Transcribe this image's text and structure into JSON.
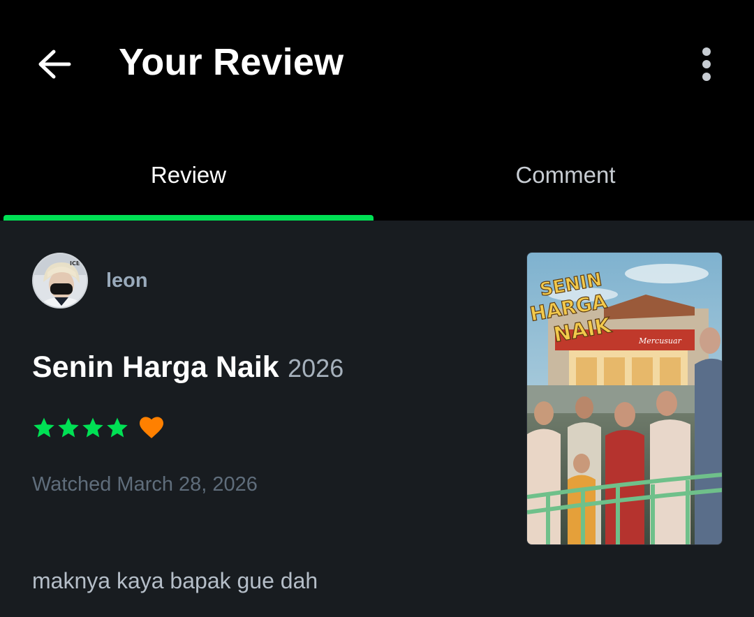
{
  "header": {
    "title": "Your Review",
    "back_icon": "arrow-left-icon",
    "more_icon": "vertical-dots-icon"
  },
  "tabs": [
    {
      "label": "Review",
      "active": true
    },
    {
      "label": "Comment",
      "active": false
    }
  ],
  "review": {
    "username": "leon",
    "avatar_badge": "ICE",
    "film_title": "Senin Harga Naik",
    "film_year": "2026",
    "stars": 4,
    "liked": true,
    "watched_text": "Watched March 28, 2026",
    "text": "maknya kaya bapak gue dah"
  },
  "poster": {
    "title_lines": [
      "SENIN",
      "HARGA",
      "NAIK"
    ],
    "store_sign": "Mercusuar"
  },
  "colors": {
    "accent": "#00e054",
    "heart": "#ff8000",
    "background": "#181c20",
    "header": "#000000"
  }
}
